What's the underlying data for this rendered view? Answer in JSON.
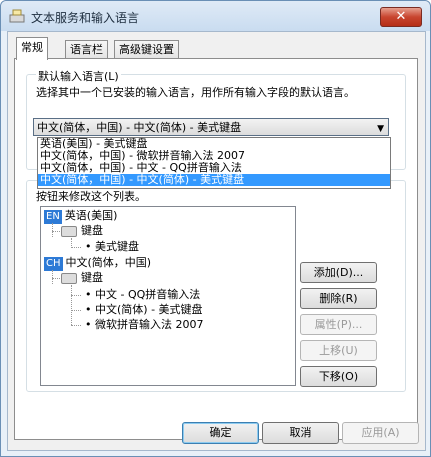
{
  "window": {
    "title": "文本服务和输入语言",
    "close_label": "✕"
  },
  "tabs": [
    "常规",
    "语言栏",
    "高级键设置"
  ],
  "default_group": {
    "label": "默认输入语言(L)",
    "description": "选择其中一个已安装的输入语言，用作所有输入字段的默认语言。",
    "selected_value": "中文(简体，中国) - 中文(简体) - 美式键盘",
    "options": [
      "英语(美国) - 美式键盘",
      "中文(简体，中国) - 微软拼音输入法 2007",
      "中文(简体，中国) - 中文 - QQ拼音输入法",
      "中文(简体，中国) - 中文(简体) - 美式键盘"
    ]
  },
  "installed_group": {
    "partial_description": "按钮来修改这个列表。"
  },
  "tree": {
    "lang1": {
      "badge": "EN",
      "name": "英语(美国)",
      "keyboard_label": "键盘",
      "items": [
        "美式键盘"
      ]
    },
    "lang2": {
      "badge": "CH",
      "name": "中文(简体，中国)",
      "keyboard_label": "键盘",
      "items": [
        "中文 - QQ拼音输入法",
        "中文(简体) - 美式键盘",
        "微软拼音输入法 2007"
      ]
    }
  },
  "side_buttons": {
    "add": "添加(D)...",
    "remove": "删除(R)",
    "properties": "属性(P)...",
    "move_up": "上移(U)",
    "move_down": "下移(O)"
  },
  "bottom_buttons": {
    "ok": "确定",
    "cancel": "取消",
    "apply": "应用(A)"
  }
}
